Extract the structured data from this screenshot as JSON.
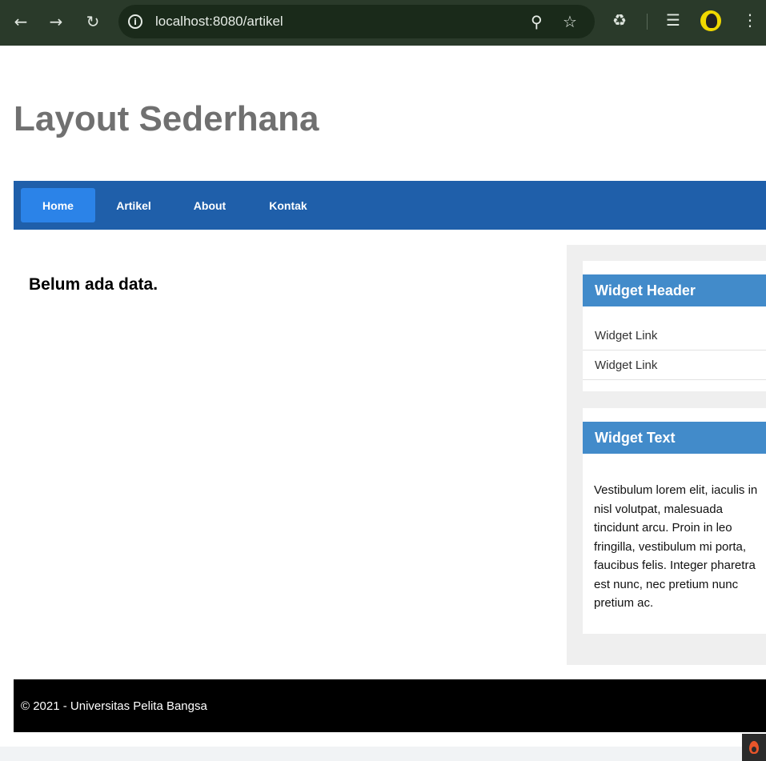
{
  "browser": {
    "url": "localhost:8080/artikel",
    "icons": [
      "back-icon",
      "forward-icon",
      "reload-icon",
      "info-icon",
      "zoom-icon",
      "star-icon",
      "extensions-icon",
      "media-icon",
      "avatar",
      "menu-icon"
    ]
  },
  "page": {
    "title": "Layout Sederhana",
    "nav": [
      {
        "label": "Home",
        "active": true
      },
      {
        "label": "Artikel",
        "active": false
      },
      {
        "label": "About",
        "active": false
      },
      {
        "label": "Kontak",
        "active": false
      }
    ],
    "content": {
      "message": "Belum ada data."
    },
    "sidebar": {
      "widget1": {
        "header": "Widget Header",
        "links": [
          "Widget Link",
          "Widget Link"
        ]
      },
      "widget2": {
        "header": "Widget Text",
        "text": "Vestibulum lorem elit, iaculis in nisl volutpat, malesuada tincidunt arcu. Proin in leo fringilla, vestibulum mi porta, faucibus felis. Integer pharetra est nunc, nec pretium nunc pretium ac."
      }
    },
    "footer": "© 2021 - Universitas Pelita Bangsa"
  },
  "colors": {
    "nav_bg": "#1f5faa",
    "nav_active": "#2b83e8",
    "widget_header": "#428bca",
    "footer_bg": "#000000",
    "title": "#707070"
  }
}
